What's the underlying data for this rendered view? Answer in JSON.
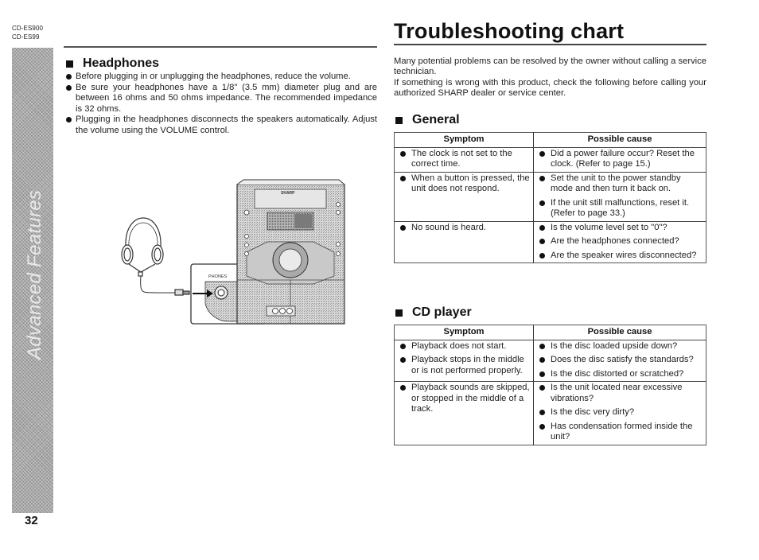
{
  "header": {
    "models": [
      "CD-ES900",
      "CD-ES99"
    ]
  },
  "side_tab": {
    "label": "Advanced Features"
  },
  "page_number": "32",
  "headphones": {
    "heading": "Headphones",
    "bullets": [
      "Before plugging in or unplugging the headphones, reduce the volume.",
      "Be sure your headphones have a 1/8\" (3.5 mm) diameter plug and are between 16 ohms and 50 ohms impedance. The recommended impedance is 32 ohms.",
      "Plugging in the headphones disconnects the speakers automatically. Adjust the volume using the VOLUME control."
    ],
    "illustration": {
      "jack_label": "PHONES",
      "brand_label": "SHARP"
    }
  },
  "troubleshooting": {
    "title": "Troubleshooting chart",
    "intro": [
      "Many potential problems can be resolved by the owner without calling a service technician.",
      "If something is wrong with this product, check the following before calling your authorized SHARP dealer or service center."
    ],
    "sections": [
      {
        "heading": "General",
        "col_symptom": "Symptom",
        "col_cause": "Possible cause",
        "rows": [
          {
            "symptoms": [
              "The clock is not set to the correct time."
            ],
            "causes": [
              "Did a power failure occur? Reset the clock. (Refer to page 15.)"
            ]
          },
          {
            "symptoms": [
              "When a button is pressed, the unit does not respond."
            ],
            "causes": [
              "Set the unit to the power standby mode and then turn it back on.",
              "If the unit still malfunctions, reset it. (Refer to page 33.)"
            ]
          },
          {
            "symptoms": [
              "No sound is heard."
            ],
            "causes": [
              "Is the volume level set to \"0\"?",
              "Are the headphones connected?",
              "Are the speaker wires disconnected?"
            ]
          }
        ]
      },
      {
        "heading": "CD player",
        "col_symptom": "Symptom",
        "col_cause": "Possible cause",
        "rows": [
          {
            "symptoms": [
              "Playback does not start.",
              "Playback stops in the middle or is not performed properly."
            ],
            "causes": [
              "Is the disc loaded upside down?",
              "Does the disc satisfy the standards?",
              "Is the disc distorted or scratched?"
            ]
          },
          {
            "symptoms": [
              "Playback sounds are skipped, or stopped in the middle of a track."
            ],
            "causes": [
              "Is the unit located near excessive vibrations?",
              "Is the disc very dirty?",
              "Has condensation formed inside the unit?"
            ]
          }
        ]
      }
    ]
  }
}
